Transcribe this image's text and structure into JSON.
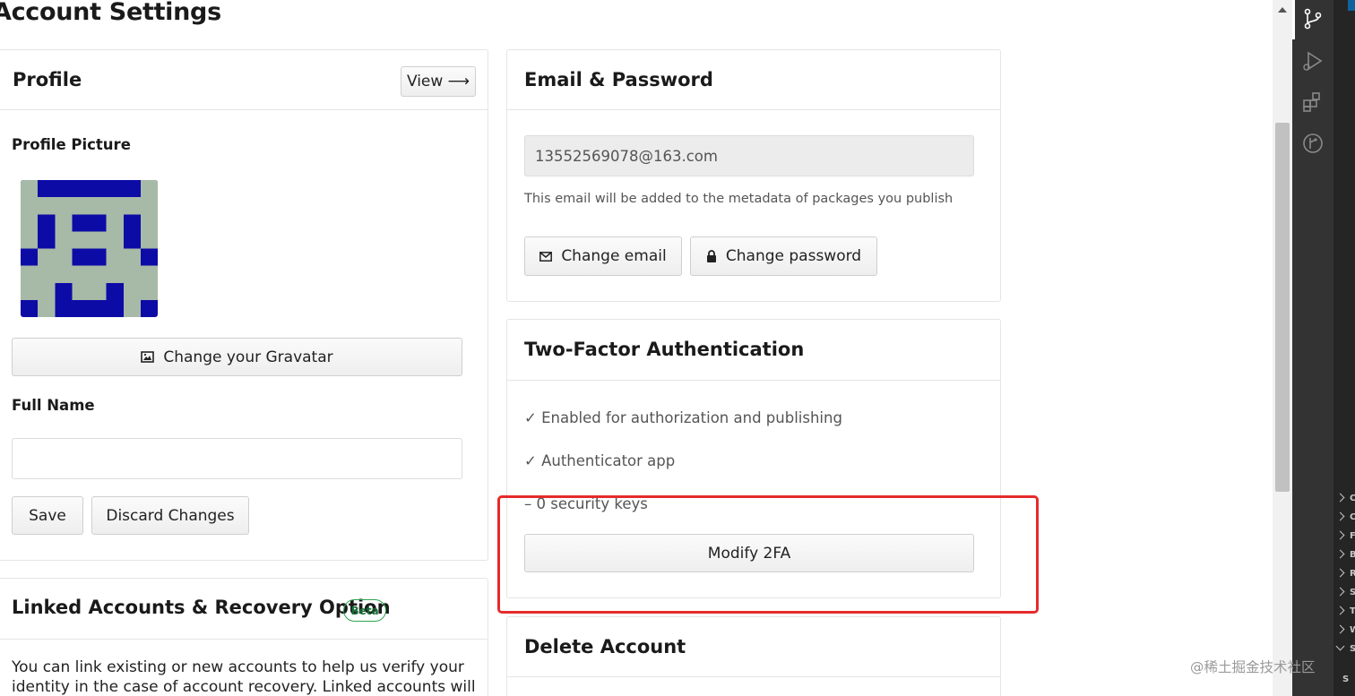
{
  "page": {
    "title": "Account Settings"
  },
  "profile": {
    "title": "Profile",
    "view_label": "View ⟶",
    "picture_label": "Profile Picture",
    "gravatar_button": "Change your Gravatar",
    "full_name_label": "Full Name",
    "full_name_value": "",
    "save_button": "Save",
    "discard_button": "Discard Changes"
  },
  "linked": {
    "title": "Linked Accounts & Recovery Option",
    "badge": "Beta",
    "desc_line1": "You can link existing or new accounts to help us verify your",
    "desc_line2": "identity in the case of account recovery. Linked accounts will"
  },
  "email_password": {
    "title": "Email & Password",
    "email_value": "13552569078@163.com",
    "email_note": "This email will be added to the metadata of packages you publish",
    "change_email_button": "Change email",
    "change_password_button": "Change password"
  },
  "two_factor": {
    "title": "Two-Factor Authentication",
    "status_1": "✓ Enabled for authorization and publishing",
    "status_2": "✓ Authenticator app",
    "status_3": "– 0 security keys",
    "modify_button": "Modify 2FA"
  },
  "delete_account": {
    "title": "Delete Account"
  },
  "editor_sidebar": {
    "rows": [
      "C",
      "C",
      "F",
      "B",
      "R",
      "S",
      "T",
      "W",
      "S"
    ],
    "extra_text": "S"
  },
  "watermark": "@稀土掘金技术社区",
  "colors": {
    "avatar_blue": "#0d0ba6",
    "avatar_gray": "#a7b9a7",
    "highlight_red": "#e52b2b",
    "beta_green": "#2ea44f"
  },
  "icons": [
    "arrow-right-icon",
    "image-icon",
    "envelope-icon",
    "lock-icon",
    "source-control-icon",
    "run-debug-icon",
    "extensions-icon",
    "git-graph-icon",
    "chevron-right-icon"
  ]
}
